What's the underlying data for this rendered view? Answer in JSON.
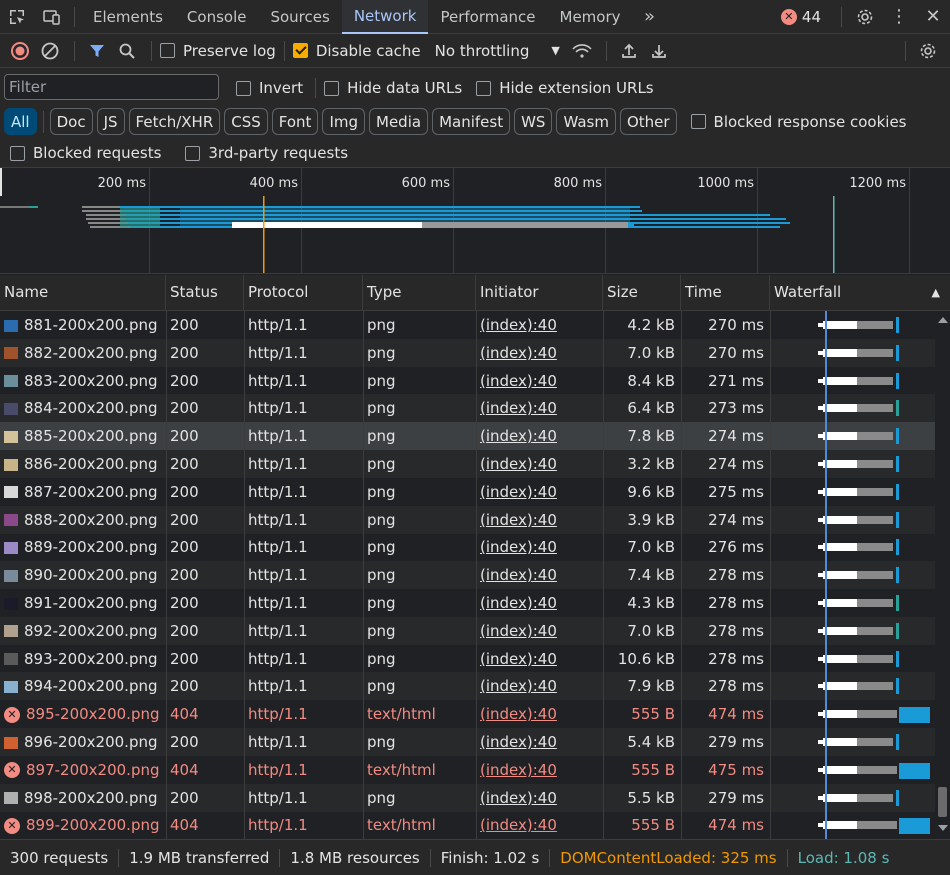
{
  "tabs": [
    {
      "label": "Elements",
      "active": false
    },
    {
      "label": "Console",
      "active": false
    },
    {
      "label": "Sources",
      "active": false
    },
    {
      "label": "Network",
      "active": true
    },
    {
      "label": "Performance",
      "active": false
    },
    {
      "label": "Memory",
      "active": false
    }
  ],
  "error_count": "44",
  "toolbar": {
    "preserve_log": "Preserve log",
    "disable_cache": "Disable cache",
    "throttling": "No throttling"
  },
  "filter": {
    "placeholder": "Filter",
    "invert": "Invert",
    "hide_data_urls": "Hide data URLs",
    "hide_extension_urls": "Hide extension URLs",
    "blocked_response_cookies": "Blocked response cookies",
    "blocked_requests": "Blocked requests",
    "third_party": "3rd-party requests",
    "types": [
      "All",
      "Doc",
      "JS",
      "Fetch/XHR",
      "CSS",
      "Font",
      "Img",
      "Media",
      "Manifest",
      "WS",
      "Wasm",
      "Other"
    ]
  },
  "overview": {
    "labels": [
      "200 ms",
      "400 ms",
      "600 ms",
      "800 ms",
      "1000 ms",
      "1200 ms"
    ]
  },
  "columns": [
    "Name",
    "Status",
    "Protocol",
    "Type",
    "Initiator",
    "Size",
    "Time",
    "Waterfall"
  ],
  "rows": [
    {
      "name": "881-200x200.png",
      "status": "200",
      "protocol": "http/1.1",
      "type": "png",
      "initiator": "(index):40",
      "size": "4.2 kB",
      "time": "270 ms",
      "error": false,
      "thumb": "#2b6cb0"
    },
    {
      "name": "882-200x200.png",
      "status": "200",
      "protocol": "http/1.1",
      "type": "png",
      "initiator": "(index):40",
      "size": "7.0 kB",
      "time": "270 ms",
      "error": false,
      "thumb": "#a0522d"
    },
    {
      "name": "883-200x200.png",
      "status": "200",
      "protocol": "http/1.1",
      "type": "png",
      "initiator": "(index):40",
      "size": "8.4 kB",
      "time": "271 ms",
      "error": false,
      "thumb": "#6b8e9b"
    },
    {
      "name": "884-200x200.png",
      "status": "200",
      "protocol": "http/1.1",
      "type": "png",
      "initiator": "(index):40",
      "size": "6.4 kB",
      "time": "273 ms",
      "error": false,
      "thumb": "#4a4a6a"
    },
    {
      "name": "885-200x200.png",
      "status": "200",
      "protocol": "http/1.1",
      "type": "png",
      "initiator": "(index):40",
      "size": "7.8 kB",
      "time": "274 ms",
      "error": false,
      "thumb": "#d4c39a"
    },
    {
      "name": "886-200x200.png",
      "status": "200",
      "protocol": "http/1.1",
      "type": "png",
      "initiator": "(index):40",
      "size": "3.2 kB",
      "time": "274 ms",
      "error": false,
      "thumb": "#c9b48a"
    },
    {
      "name": "887-200x200.png",
      "status": "200",
      "protocol": "http/1.1",
      "type": "png",
      "initiator": "(index):40",
      "size": "9.6 kB",
      "time": "275 ms",
      "error": false,
      "thumb": "#d8d8d8"
    },
    {
      "name": "888-200x200.png",
      "status": "200",
      "protocol": "http/1.1",
      "type": "png",
      "initiator": "(index):40",
      "size": "3.9 kB",
      "time": "274 ms",
      "error": false,
      "thumb": "#8a4a8a"
    },
    {
      "name": "889-200x200.png",
      "status": "200",
      "protocol": "http/1.1",
      "type": "png",
      "initiator": "(index):40",
      "size": "7.0 kB",
      "time": "276 ms",
      "error": false,
      "thumb": "#9a8ac8"
    },
    {
      "name": "890-200x200.png",
      "status": "200",
      "protocol": "http/1.1",
      "type": "png",
      "initiator": "(index):40",
      "size": "7.4 kB",
      "time": "278 ms",
      "error": false,
      "thumb": "#7a8a9a"
    },
    {
      "name": "891-200x200.png",
      "status": "200",
      "protocol": "http/1.1",
      "type": "png",
      "initiator": "(index):40",
      "size": "4.3 kB",
      "time": "278 ms",
      "error": false,
      "thumb": "#1a1a2a"
    },
    {
      "name": "892-200x200.png",
      "status": "200",
      "protocol": "http/1.1",
      "type": "png",
      "initiator": "(index):40",
      "size": "7.0 kB",
      "time": "278 ms",
      "error": false,
      "thumb": "#b0a090"
    },
    {
      "name": "893-200x200.png",
      "status": "200",
      "protocol": "http/1.1",
      "type": "png",
      "initiator": "(index):40",
      "size": "10.6 kB",
      "time": "278 ms",
      "error": false,
      "thumb": "#5a5a5a"
    },
    {
      "name": "894-200x200.png",
      "status": "200",
      "protocol": "http/1.1",
      "type": "png",
      "initiator": "(index):40",
      "size": "7.9 kB",
      "time": "278 ms",
      "error": false,
      "thumb": "#8ab0d0"
    },
    {
      "name": "895-200x200.png",
      "status": "404",
      "protocol": "http/1.1",
      "type": "text/html",
      "initiator": "(index):40",
      "size": "555 B",
      "time": "474 ms",
      "error": true,
      "thumb": ""
    },
    {
      "name": "896-200x200.png",
      "status": "200",
      "protocol": "http/1.1",
      "type": "png",
      "initiator": "(index):40",
      "size": "5.4 kB",
      "time": "279 ms",
      "error": false,
      "thumb": "#d06030"
    },
    {
      "name": "897-200x200.png",
      "status": "404",
      "protocol": "http/1.1",
      "type": "text/html",
      "initiator": "(index):40",
      "size": "555 B",
      "time": "475 ms",
      "error": true,
      "thumb": ""
    },
    {
      "name": "898-200x200.png",
      "status": "200",
      "protocol": "http/1.1",
      "type": "png",
      "initiator": "(index):40",
      "size": "5.5 kB",
      "time": "279 ms",
      "error": false,
      "thumb": "#b0b0b0"
    },
    {
      "name": "899-200x200.png",
      "status": "404",
      "protocol": "http/1.1",
      "type": "text/html",
      "initiator": "(index):40",
      "size": "555 B",
      "time": "474 ms",
      "error": true,
      "thumb": ""
    }
  ],
  "status_bar": {
    "requests": "300 requests",
    "transferred": "1.9 MB transferred",
    "resources": "1.8 MB resources",
    "finish": "Finish: 1.02 s",
    "dom_loaded": "DOMContentLoaded: 325 ms",
    "load": "Load: 1.08 s"
  },
  "colors": {
    "accent": "#a8c7fa",
    "error": "#f28b82",
    "dom_content_loaded": "#f29900",
    "load": "#5bb9b5",
    "waterfall_blue": "#1a9bd7"
  }
}
